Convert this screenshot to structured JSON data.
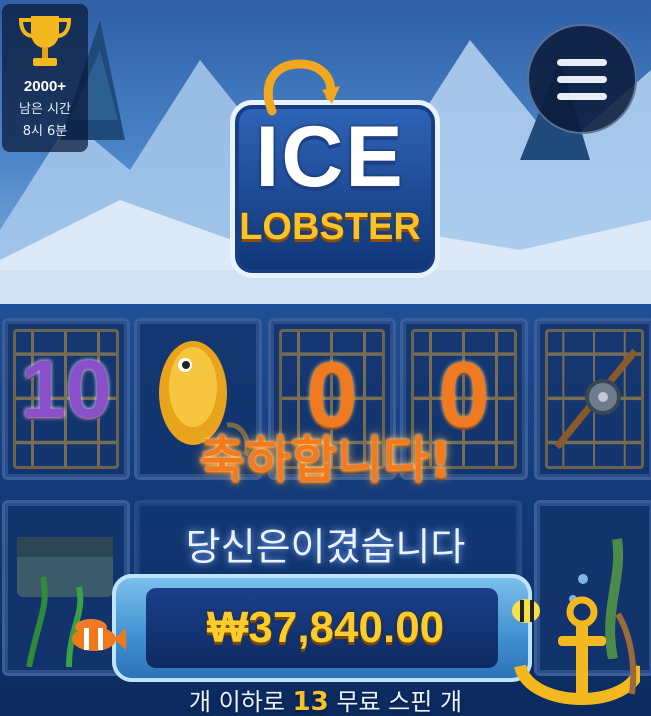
{
  "trophy": {
    "icon": "trophy-icon",
    "count": "2000+",
    "time_label": "남은 시간",
    "time_value": "8시 6분"
  },
  "menu": {
    "icon": "hamburger-menu-icon"
  },
  "logo": {
    "line1": "ICE",
    "line2": "LOBSTER"
  },
  "reels": {
    "row1": [
      {
        "symbol": "10"
      },
      {
        "symbol": "golden-fish"
      },
      {
        "symbol": "0"
      },
      {
        "symbol": "0"
      },
      {
        "symbol": "fishing-rod"
      }
    ],
    "row2": [
      {
        "symbol": "treasure-chest"
      }
    ]
  },
  "win": {
    "congrats": "축하합니다!",
    "you_won": "당신은이겼습니다",
    "amount": "₩37,840.00",
    "spins_prefix": "개 이하로",
    "spins_count": "13",
    "spins_suffix": "무료 스핀 개"
  },
  "colors": {
    "gold": "#fbcd2c",
    "orange": "#f47a1b",
    "deep_blue": "#0d2a5c"
  }
}
